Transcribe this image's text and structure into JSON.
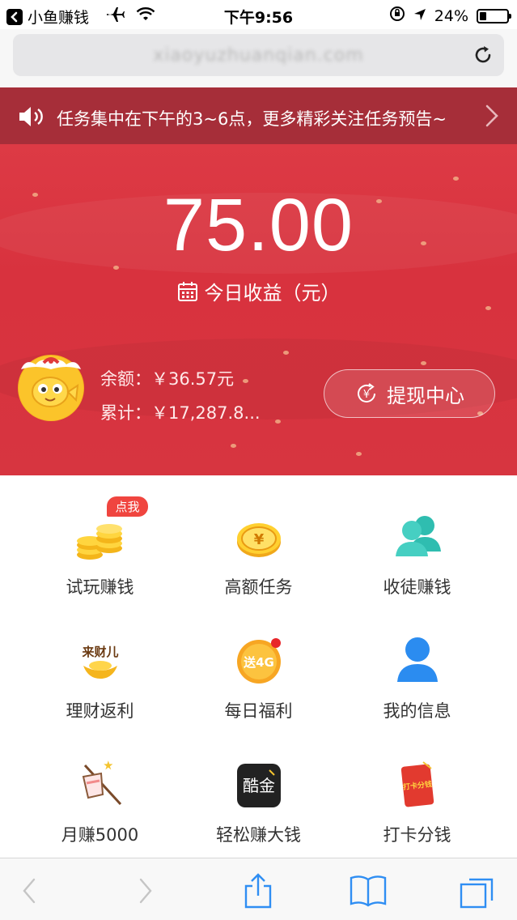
{
  "status_bar": {
    "back_app_label": "小鱼赚钱",
    "time": "下午9:56",
    "battery_percent": "24%",
    "battery_level": 0.24
  },
  "browser": {
    "url": "xiaoyuzhuanqian.com"
  },
  "notice": {
    "text": "任务集中在下午的3~6点，更多精彩关注任务预告~"
  },
  "hero": {
    "today_amount": "75.00",
    "today_label": "今日收益（元）",
    "balance": "余额：￥36.57元",
    "total": "累计：￥17,287.8...",
    "withdraw_label": "提现中心"
  },
  "grid": {
    "items": [
      {
        "label": "试玩赚钱",
        "icon": "coins-icon",
        "badge": "点我"
      },
      {
        "label": "高额任务",
        "icon": "yuan-coin-icon"
      },
      {
        "label": "收徒赚钱",
        "icon": "users-icon"
      },
      {
        "label": "理财返利",
        "icon": "gold-ingot-icon",
        "icon_text": "来财儿"
      },
      {
        "label": "每日福利",
        "icon": "gift-4g-icon",
        "icon_text": "送4G"
      },
      {
        "label": "我的信息",
        "icon": "user-icon"
      },
      {
        "label": "月赚5000",
        "icon": "cup-icon"
      },
      {
        "label": "轻松赚大钱",
        "icon": "kujin-app-icon",
        "icon_text": "酷金"
      },
      {
        "label": "打卡分钱",
        "icon": "red-envelope-icon",
        "icon_text": "打卡分钱"
      }
    ]
  },
  "colors": {
    "hero_red": "#d8323e",
    "notice_red": "#a62e39",
    "accent_blue": "#2b8cf0",
    "teal": "#33c0b5"
  }
}
